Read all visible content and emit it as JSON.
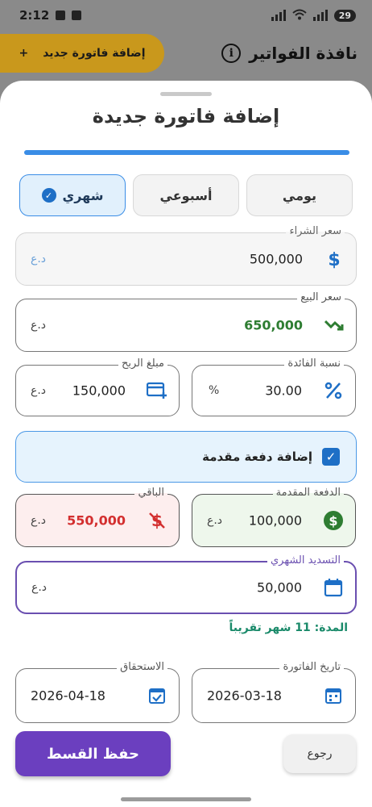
{
  "status_bar": {
    "time": "2:12",
    "battery": "29"
  },
  "background": {
    "title": "نافذة الفواتير",
    "add_button": "إضافة فاتورة جديد",
    "add_icon": "+",
    "info_icon": "i"
  },
  "sheet": {
    "title": "إضافة فاتورة جديدة",
    "periods": [
      {
        "label": "يومي",
        "selected": false
      },
      {
        "label": "أسبوعي",
        "selected": false
      },
      {
        "label": "شهري",
        "selected": true
      }
    ],
    "purchase_price": {
      "label": "سعر الشراء",
      "value": "500,000",
      "currency": "د.ع",
      "icon": "dollar-icon"
    },
    "sale_price": {
      "label": "سعر البيع",
      "value": "650,000",
      "currency": "د.ع",
      "icon": "trend-icon",
      "value_color": "#2e7d32"
    },
    "interest_rate": {
      "label": "نسبة الفائدة",
      "value": "30.00",
      "unit": "%",
      "icon": "percent-icon"
    },
    "profit_amount": {
      "label": "مبلغ الربح",
      "value": "150,000",
      "currency": "د.ع",
      "icon": "card-add-icon"
    },
    "downpayment_toggle": {
      "label": "إضافة دفعة مقدمة",
      "checked": true
    },
    "downpayment": {
      "label": "الدفعة المقدمة",
      "value": "100,000",
      "currency": "د.ع",
      "icon": "money-circle-icon"
    },
    "remaining": {
      "label": "الباقي",
      "value": "550,000",
      "currency": "د.ع",
      "icon": "money-off-icon",
      "value_color": "#d32f2f"
    },
    "monthly_payment": {
      "label": "التسديد الشهري",
      "value": "50,000",
      "currency": "د.ع",
      "icon": "calendar-icon"
    },
    "duration": "المدة: 11 شهر تقريباً",
    "invoice_date": {
      "label": "تاريخ الفاتورة",
      "value": "2026-03-18",
      "icon": "calendar-icon"
    },
    "due_date": {
      "label": "الاستحقاق",
      "value": "2026-04-18",
      "icon": "calendar-check-icon"
    },
    "save_button": "حفظ القسط",
    "back_button": "رجوع"
  },
  "colors": {
    "accent": "#3a8de6",
    "primary": "#6b3fbf",
    "success": "#2e7d32",
    "danger": "#d32f2f"
  }
}
